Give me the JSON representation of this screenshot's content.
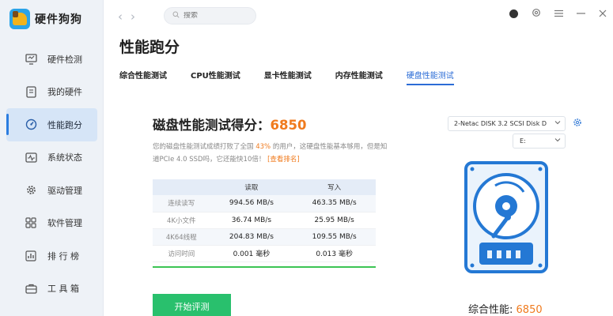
{
  "app": {
    "title": "硬件狗狗"
  },
  "sidebar": {
    "items": [
      {
        "label": "硬件检测",
        "icon": "monitor-icon"
      },
      {
        "label": "我的硬件",
        "icon": "document-icon"
      },
      {
        "label": "性能跑分",
        "icon": "gauge-icon",
        "active": true
      },
      {
        "label": "系统状态",
        "icon": "pulse-icon"
      },
      {
        "label": "驱动管理",
        "icon": "gear-icon"
      },
      {
        "label": "软件管理",
        "icon": "apps-icon"
      },
      {
        "label": "排 行 榜",
        "icon": "ranking-icon"
      },
      {
        "label": "工 具 箱",
        "icon": "toolbox-icon"
      }
    ]
  },
  "topbar": {
    "search_placeholder": "搜索"
  },
  "page": {
    "title": "性能跑分",
    "tabs": [
      "综合性能测试",
      "CPU性能测试",
      "显卡性能测试",
      "内存性能测试",
      "硬盘性能测试"
    ],
    "active_tab": 4
  },
  "score": {
    "label": "磁盘性能测试得分：",
    "value": "6850",
    "desc_prefix": "您的磁盘性能测试成绩打败了全国 ",
    "desc_pct": "43%",
    "desc_mid": " 的用户，这硬盘性能基本够用，但是知道PCIe 4.0 SSD吗，它还能快10倍！",
    "desc_link": "[查看排名]"
  },
  "table": {
    "headers": [
      "",
      "读取",
      "写入"
    ],
    "rows": [
      {
        "label": "连续读写",
        "read": "994.56 MB/s",
        "write": "463.35 MB/s"
      },
      {
        "label": "4K小文件",
        "read": "36.74 MB/s",
        "write": "25.95 MB/s"
      },
      {
        "label": "4K64线程",
        "read": "204.83 MB/s",
        "write": "109.55 MB/s"
      },
      {
        "label": "访问时间",
        "read": "0.001 毫秒",
        "write": "0.013 毫秒"
      }
    ]
  },
  "start_button": "开始评测",
  "disk": {
    "selected": "2-Netac DISK 3.2 SCSI Disk D",
    "drive": "E:"
  },
  "overall": {
    "label": "综合性能:",
    "value": "6850"
  },
  "colors": {
    "accent": "#2b6cd6",
    "score": "#f07b1e",
    "start": "#29c06d",
    "progress": "#3cc454"
  }
}
